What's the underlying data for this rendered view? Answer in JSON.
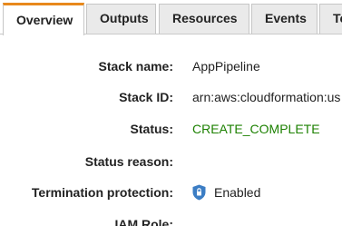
{
  "tabs": [
    {
      "label": "Overview",
      "active": true
    },
    {
      "label": "Outputs",
      "active": false
    },
    {
      "label": "Resources",
      "active": false
    },
    {
      "label": "Events",
      "active": false
    },
    {
      "label": "Te",
      "active": false
    }
  ],
  "overview": {
    "stack_name": {
      "label": "Stack name:",
      "value": "AppPipeline"
    },
    "stack_id": {
      "label": "Stack ID:",
      "value": "arn:aws:cloudformation:us"
    },
    "status": {
      "label": "Status:",
      "value": "CREATE_COMPLETE",
      "color": "#1d8102"
    },
    "status_reason": {
      "label": "Status reason:",
      "value": ""
    },
    "termination_protection": {
      "label": "Termination protection:",
      "value": "Enabled",
      "icon": "shield-lock-icon"
    },
    "iam_role": {
      "label": "IAM Role:",
      "value": ""
    }
  },
  "colors": {
    "active_tab_accent": "#e8891c",
    "status_green": "#1d8102",
    "shield_blue": "#3b7dc4"
  }
}
